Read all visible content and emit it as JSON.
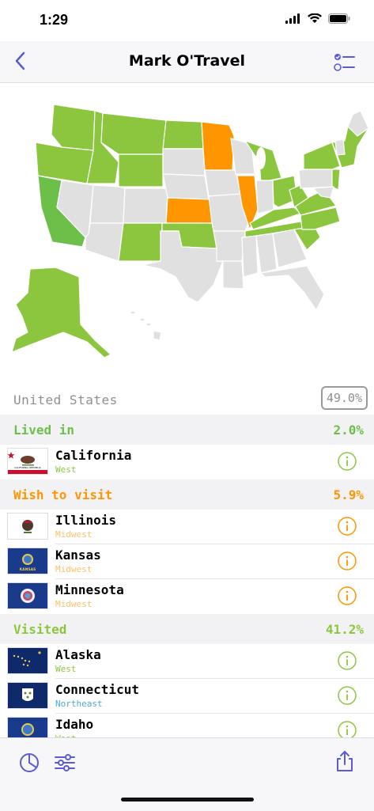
{
  "status": {
    "time": "1:29"
  },
  "nav": {
    "title": "Mark O'Travel"
  },
  "summary": {
    "label": "United States",
    "percent": "49.0%"
  },
  "colors": {
    "lived": "#6cc04a",
    "wish": "#ff9500",
    "visited": "#8cc63f",
    "accent": "#5b5bd6",
    "state_default": "#e0e0e0"
  },
  "sections": {
    "lived": {
      "title": "Lived in",
      "value": "2.0%",
      "items": [
        {
          "name": "California",
          "region": "West"
        }
      ]
    },
    "wish": {
      "title": "Wish to visit",
      "value": "5.9%",
      "items": [
        {
          "name": "Illinois",
          "region": "Midwest"
        },
        {
          "name": "Kansas",
          "region": "Midwest"
        },
        {
          "name": "Minnesota",
          "region": "Midwest"
        }
      ]
    },
    "visited": {
      "title": "Visited",
      "value": "41.2%",
      "items": [
        {
          "name": "Alaska",
          "region": "West"
        },
        {
          "name": "Connecticut",
          "region": "Northeast"
        },
        {
          "name": "Idaho",
          "region": "West"
        }
      ]
    }
  },
  "flags": {
    "california": "CALIFORNIA REPUBLIC",
    "kansas": "KANSAS"
  }
}
